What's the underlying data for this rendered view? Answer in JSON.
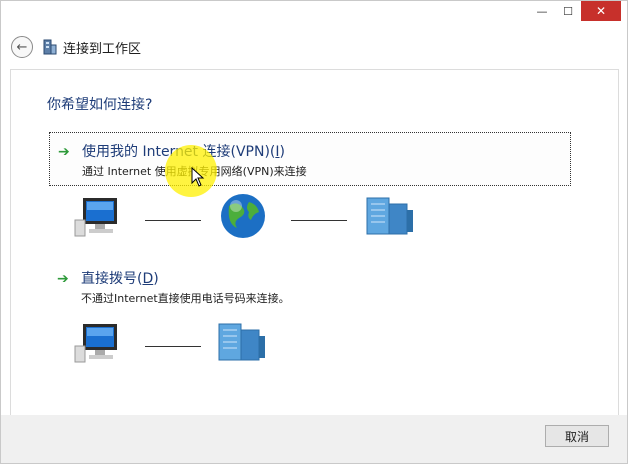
{
  "window": {
    "controls": {
      "minimize": "—",
      "maximize": "☐",
      "close": "✕"
    }
  },
  "header": {
    "back_icon": "back-arrow-icon",
    "title": "连接到工作区"
  },
  "question": "你希望如何连接?",
  "options": [
    {
      "title_prefix": "使用我的 Internet 连接(VPN)(",
      "accelerator": "I",
      "title_suffix": ")",
      "description": "通过 Internet 使用虚拟专用网络(VPN)来连接",
      "selected": true,
      "diagram": [
        "computer-icon",
        "globe-icon",
        "server-icon"
      ]
    },
    {
      "title_prefix": "直接拨号(",
      "accelerator": "D",
      "title_suffix": ")",
      "description": "不通过Internet直接使用电话号码来连接。",
      "selected": false,
      "diagram": [
        "computer-icon",
        "server-icon"
      ]
    }
  ],
  "buttons": {
    "cancel": "取消"
  },
  "colors": {
    "heading": "#1e3c78",
    "arrow": "#2e9a3a",
    "close": "#c7302b"
  }
}
